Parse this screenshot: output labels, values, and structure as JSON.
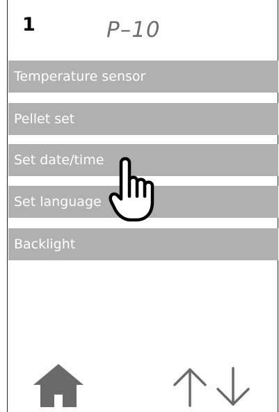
{
  "header": {
    "step_number": "1",
    "title": "P–10"
  },
  "menu": {
    "items": [
      {
        "label": "Temperature sensor"
      },
      {
        "label": "Pellet set"
      },
      {
        "label": "Set date/time"
      },
      {
        "label": "Set language"
      },
      {
        "label": "Backlight"
      }
    ]
  },
  "footer": {
    "icons": [
      "home-icon",
      "arrow-up-icon",
      "arrow-down-icon"
    ]
  },
  "overlay": {
    "pointer_icon": "pointing-hand-icon"
  },
  "colors": {
    "menu_item_bg": "#b0b0b0",
    "menu_item_text": "#ffffff",
    "title": "#6f6f6f",
    "icons": "#6a6a6a"
  }
}
